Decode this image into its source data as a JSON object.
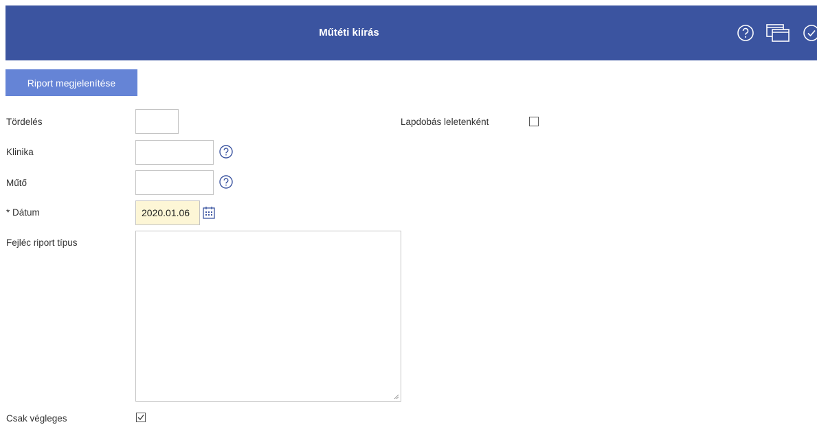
{
  "header": {
    "title": "Műtéti kiírás",
    "icons": [
      "help-icon",
      "windows-icon",
      "check-circle-icon"
    ],
    "background": "#3b54a0"
  },
  "toolbar": {
    "report_button_label": "Riport megjelenítése",
    "report_button_color": "#6584d6"
  },
  "form": {
    "tordeles": {
      "label": "Tördelés",
      "value": ""
    },
    "lapdobas": {
      "label": "Lapdobás leletenként",
      "checked": false
    },
    "klinika": {
      "label": "Klinika",
      "value": ""
    },
    "muto": {
      "label": "Műtő",
      "value": ""
    },
    "datum": {
      "label": "* Dátum",
      "value": "2020.01.06",
      "field_color": "#fdf6d6"
    },
    "fejlec": {
      "label": "Fejléc riport típus",
      "value": ""
    },
    "csak_vegleges": {
      "label": "Csak végleges",
      "checked": true
    }
  }
}
